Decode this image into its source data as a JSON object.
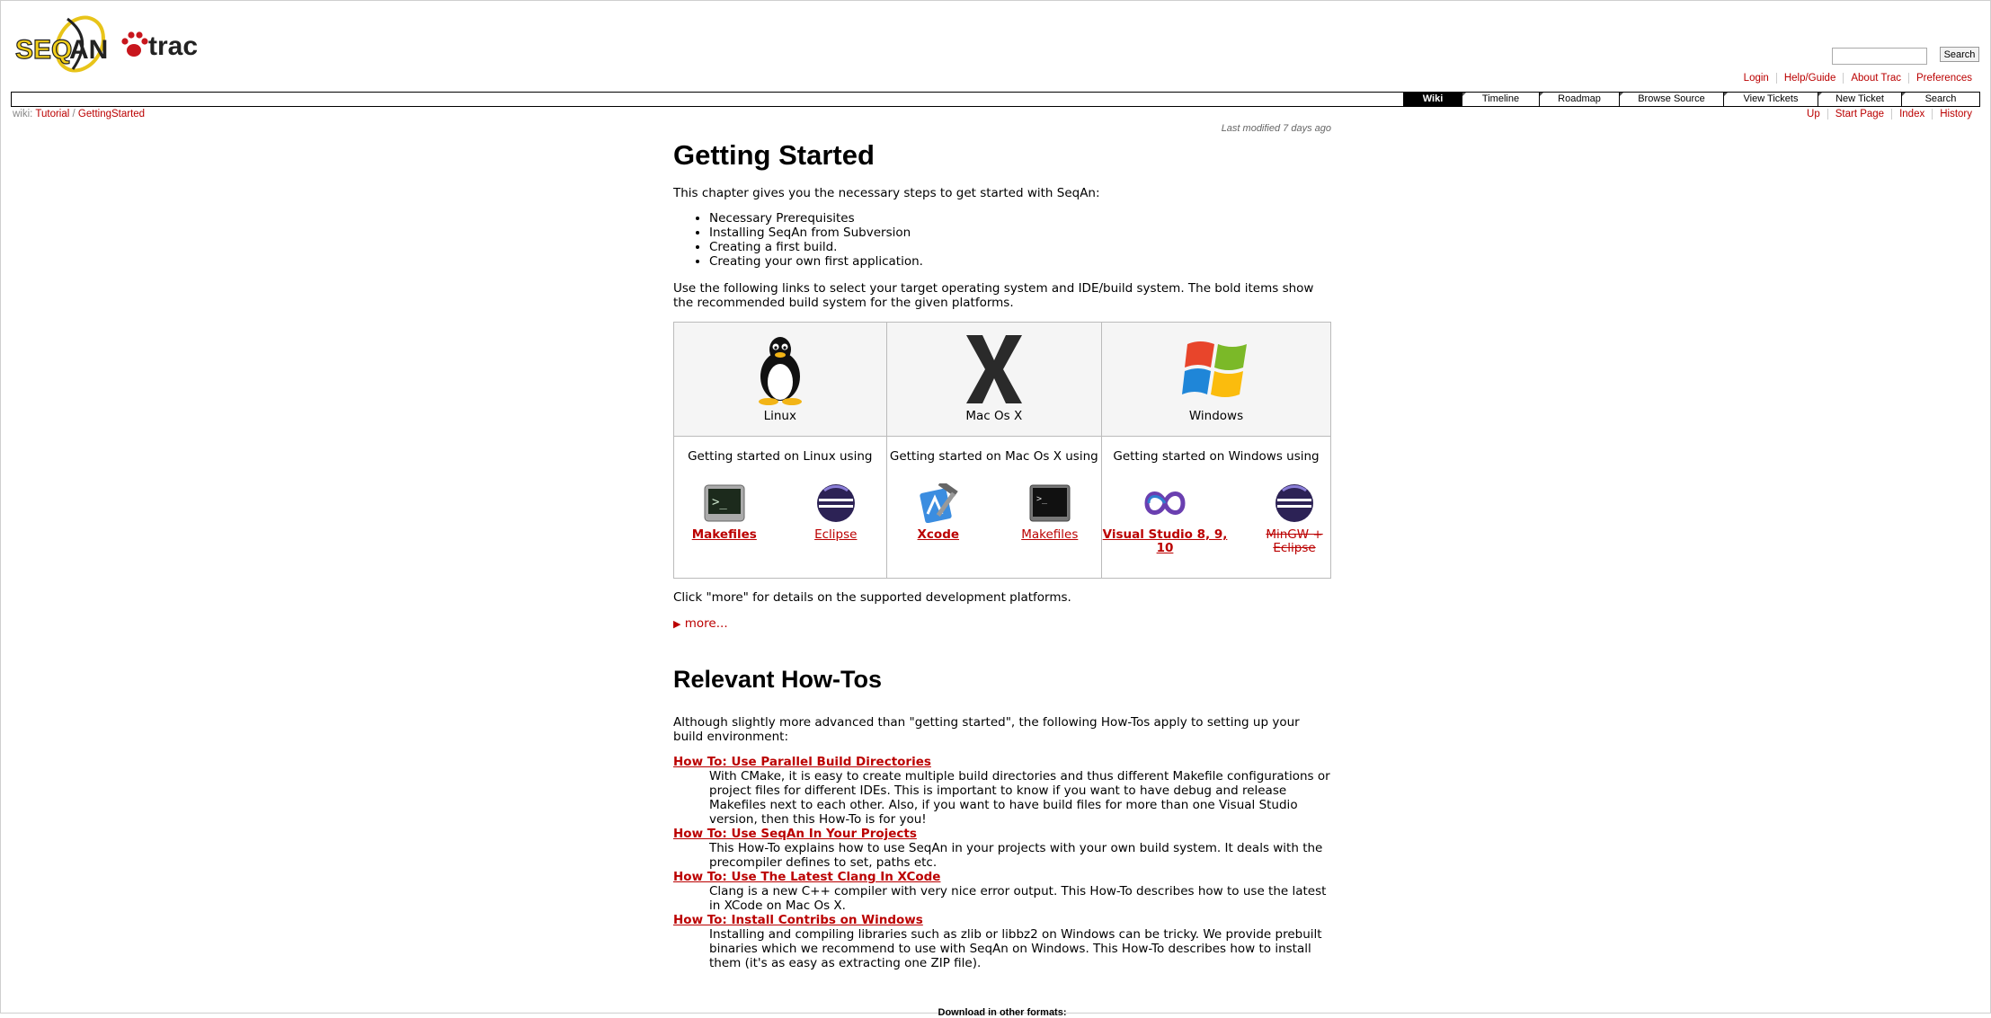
{
  "header": {
    "logo_alt": "SEQAN trac",
    "search_button": "Search",
    "search_placeholder": ""
  },
  "metanav": [
    "Login",
    "Help/Guide",
    "About Trac",
    "Preferences"
  ],
  "mainnav": [
    {
      "label": "Wiki",
      "active": true
    },
    {
      "label": "Timeline"
    },
    {
      "label": "Roadmap"
    },
    {
      "label": "Browse Source"
    },
    {
      "label": "View Tickets"
    },
    {
      "label": "New Ticket"
    },
    {
      "label": "Search"
    }
  ],
  "breadcrumb": {
    "prefix": "wiki:",
    "items": [
      "Tutorial",
      "GettingStarted"
    ],
    "sep": "/"
  },
  "ctxtnav": [
    "Up",
    "Start Page",
    "Index",
    "History"
  ],
  "last_modified": "Last modified 7 days ago",
  "page": {
    "title": "Getting Started",
    "intro": "This chapter gives you the necessary steps to get started with SeqAn:",
    "steps": [
      "Necessary Prerequisites",
      "Installing SeqAn from Subversion",
      "Creating a first build.",
      "Creating your own first application."
    ],
    "links_text": "Use the following links to select your target operating system and IDE/build system. The bold items show the recommended build system for the given platforms.",
    "platforms": [
      {
        "name": "Linux",
        "using": "Getting started on Linux using",
        "tools": [
          {
            "label": "Makefiles",
            "icon": "terminal-icon",
            "bold": true
          },
          {
            "label": "Eclipse",
            "icon": "eclipse-icon"
          }
        ]
      },
      {
        "name": "Mac Os X",
        "using": "Getting started on Mac Os X using",
        "tools": [
          {
            "label": "Xcode",
            "icon": "xcode-icon",
            "bold": true
          },
          {
            "label": "Makefiles",
            "icon": "terminal-icon"
          }
        ]
      },
      {
        "name": "Windows",
        "using": "Getting started on Windows using",
        "tools": [
          {
            "label": "Visual Studio 8, 9, 10",
            "icon": "visual-studio-icon",
            "bold": true
          },
          {
            "label": "MinGW + Eclipse",
            "icon": "eclipse-icon",
            "strike": true
          }
        ]
      }
    ],
    "click_more": "Click \"more\" for details on the supported development platforms.",
    "more_label": "more...",
    "howtos_title": "Relevant How-Tos",
    "howtos_intro": "Although slightly more advanced than \"getting started\", the following How-Tos apply to setting up your build environment:",
    "howtos": [
      {
        "title": "How To: Use Parallel Build Directories",
        "desc": "With CMake, it is easy to create multiple build directories and thus different Makefile configurations or project files for different IDEs. This is important to know if you want to have debug and release Makefiles next to each other. Also, if you want to have build files for more than one Visual Studio version, then this How-To is for you!"
      },
      {
        "title": "How To: Use SeqAn In Your Projects",
        "desc": "This How-To explains how to use SeqAn in your projects with your own build system. It deals with the precompiler defines to set, paths etc."
      },
      {
        "title": "How To: Use The Latest Clang In XCode",
        "desc": "Clang is a new C++ compiler with very nice error output. This How-To describes how to use the latest in XCode on Mac Os X."
      },
      {
        "title": "How To: Install Contribs on Windows",
        "desc": "Installing and compiling libraries such as zlib or libbz2 on Windows can be tricky. We provide prebuilt binaries which we recommend to use with SeqAn on Windows. This How-To describes how to install them (it's as easy as extracting one ZIP file)."
      }
    ],
    "download_formats": "Download in other formats:"
  },
  "colors": {
    "link": "#bb0000",
    "nav_active": "#000000"
  }
}
